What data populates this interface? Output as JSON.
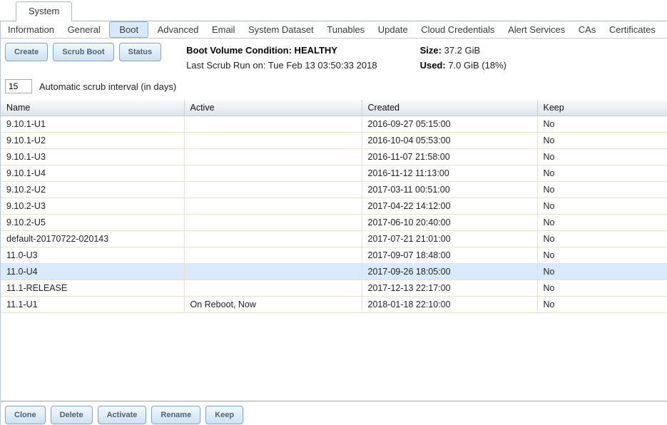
{
  "window": {
    "tab_label": "System"
  },
  "nav": {
    "items": [
      {
        "label": "Information",
        "active": false
      },
      {
        "label": "General",
        "active": false
      },
      {
        "label": "Boot",
        "active": true
      },
      {
        "label": "Advanced",
        "active": false
      },
      {
        "label": "Email",
        "active": false
      },
      {
        "label": "System Dataset",
        "active": false
      },
      {
        "label": "Tunables",
        "active": false
      },
      {
        "label": "Update",
        "active": false
      },
      {
        "label": "Cloud Credentials",
        "active": false
      },
      {
        "label": "Alert Services",
        "active": false
      },
      {
        "label": "CAs",
        "active": false
      },
      {
        "label": "Certificates",
        "active": false
      }
    ]
  },
  "toolbar": {
    "buttons": [
      "Create",
      "Scrub Boot",
      "Status"
    ],
    "status": {
      "condition_line": "Boot Volume Condition: HEALTHY",
      "last_scrub_line": "Last Scrub Run on: Tue Feb 13 03:50:33 2018",
      "size_label": "Size:",
      "size_value": "37.2 GiB",
      "used_label": "Used:",
      "used_value": "7.0 GiB (18%)"
    },
    "scrub_interval": {
      "value": "15",
      "label": "Automatic scrub interval (in days)"
    }
  },
  "table": {
    "columns": [
      "Name",
      "Active",
      "Created",
      "Keep"
    ],
    "rows": [
      {
        "name": "9.10.1-U1",
        "active": "",
        "created": "2016-09-27 05:15:00",
        "keep": "No",
        "selected": false
      },
      {
        "name": "9.10.1-U2",
        "active": "",
        "created": "2016-10-04 05:53:00",
        "keep": "No",
        "selected": false
      },
      {
        "name": "9.10.1-U3",
        "active": "",
        "created": "2016-11-07 21:58:00",
        "keep": "No",
        "selected": false
      },
      {
        "name": "9.10.1-U4",
        "active": "",
        "created": "2016-11-12 11:13:00",
        "keep": "No",
        "selected": false
      },
      {
        "name": "9.10.2-U2",
        "active": "",
        "created": "2017-03-11 00:51:00",
        "keep": "No",
        "selected": false
      },
      {
        "name": "9.10.2-U3",
        "active": "",
        "created": "2017-04-22 14:12:00",
        "keep": "No",
        "selected": false
      },
      {
        "name": "9.10.2-U5",
        "active": "",
        "created": "2017-06-10 20:40:00",
        "keep": "No",
        "selected": false
      },
      {
        "name": "default-20170722-020143",
        "active": "",
        "created": "2017-07-21 21:01:00",
        "keep": "No",
        "selected": false
      },
      {
        "name": "11.0-U3",
        "active": "",
        "created": "2017-09-07 18:48:00",
        "keep": "No",
        "selected": false
      },
      {
        "name": "11.0-U4",
        "active": "",
        "created": "2017-09-26 18:05:00",
        "keep": "No",
        "selected": true
      },
      {
        "name": "11.1-RELEASE",
        "active": "",
        "created": "2017-12-13 22:17:00",
        "keep": "No",
        "selected": false
      },
      {
        "name": "11.1-U1",
        "active": "On Reboot, Now",
        "created": "2018-01-18 22:10:00",
        "keep": "No",
        "selected": false
      }
    ]
  },
  "footer": {
    "buttons": [
      "Clone",
      "Delete",
      "Activate",
      "Rename",
      "Keep"
    ]
  },
  "colors": {
    "active_tab_bg": "#d8e9fb",
    "active_tab_border": "#8ab2dd",
    "selected_row_bg": "#daeafa",
    "button_border": "#7fa3c9",
    "row_border": "#ecdfc8",
    "header_border": "#bfc9d2"
  }
}
